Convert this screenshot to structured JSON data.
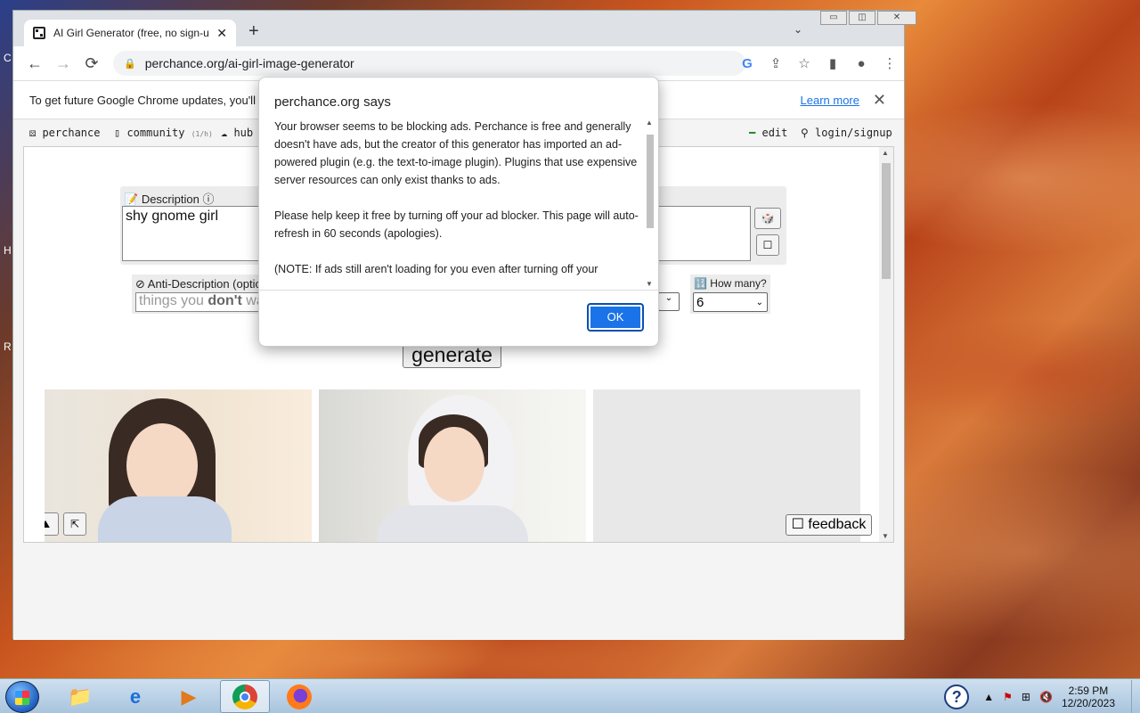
{
  "desktop": {
    "side_letters": [
      "C",
      "H",
      "R"
    ]
  },
  "window": {
    "controls": [
      "▭",
      "◫",
      "✕"
    ]
  },
  "tab": {
    "title": "AI Girl Generator (free, no sign-u",
    "close": "✕",
    "new_tab": "+",
    "tab_search": "⌄"
  },
  "toolbar": {
    "back": "←",
    "forward": "→",
    "reload": "⟳",
    "url": "perchance.org/ai-girl-image-generator",
    "icons": [
      "G",
      "⇪",
      "☆",
      "▮",
      "●",
      "⋮"
    ]
  },
  "infobar": {
    "text": "To get future Google Chrome updates, you'll",
    "learn_more": "Learn more",
    "close": "✕"
  },
  "sitenav": {
    "perchance": "perchance",
    "community": "community",
    "community_badge": "(1/h)",
    "hub": "hub",
    "edit": "edit",
    "login": "login/signup"
  },
  "generator": {
    "description_label": "Description",
    "description_value": "shy gnome girl",
    "side_btn_1": "🎲",
    "side_btn_2": "☐",
    "anti_label": "Anti-Description (optic",
    "anti_placeholder_pre": "things you ",
    "anti_placeholder_bold": "don't",
    "anti_placeholder_post": " wa",
    "how_many_label": "How many?",
    "how_many_value": "6",
    "generate": "generate",
    "feedback": "feedback"
  },
  "dialog": {
    "title": "perchance.org says",
    "para1": "Your browser seems to be blocking ads. Perchance is free and generally doesn't have ads, but the creator of this generator has imported an ad-powered plugin (e.g. the text-to-image plugin). Plugins that use expensive server resources can only exist thanks to ads.",
    "para2": "Please help keep it free by turning off your ad blocker. This page will auto-refresh in 60 seconds (apologies).",
    "para3": "(NOTE: If ads still aren't loading for you even after turning off your",
    "ok": "OK"
  },
  "taskbar": {
    "apps": [
      "explorer",
      "internet-explorer",
      "media-player",
      "chrome",
      "firefox"
    ],
    "time": "2:59 PM",
    "date": "12/20/2023"
  }
}
